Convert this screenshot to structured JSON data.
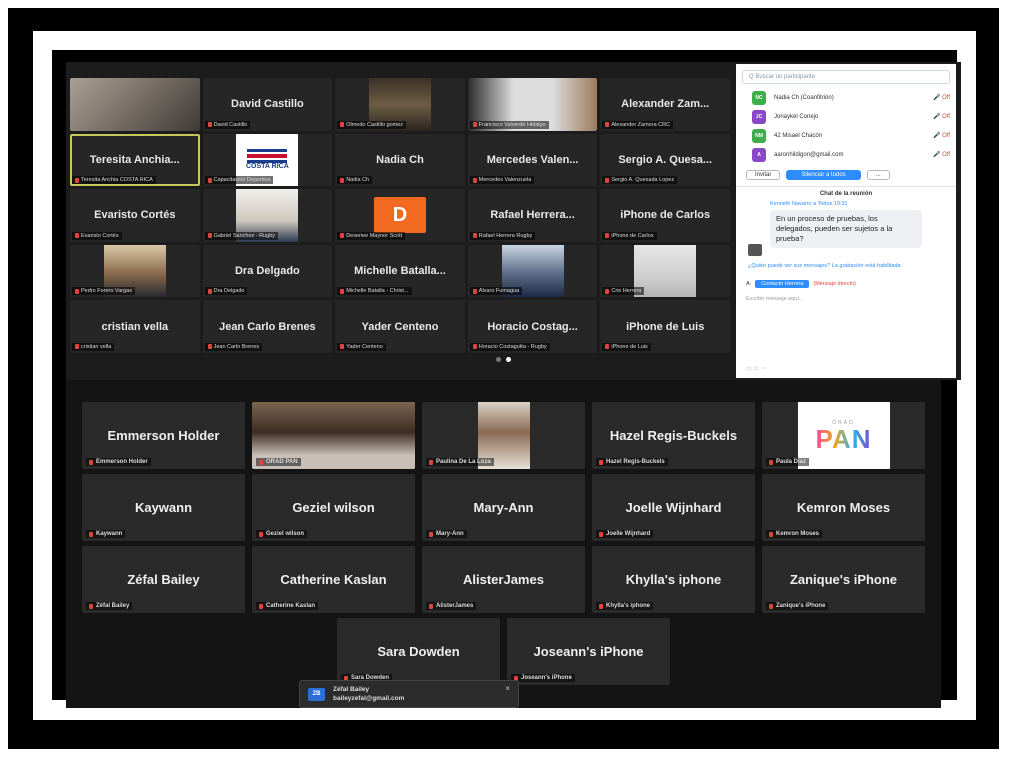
{
  "top": {
    "tiles": [
      {
        "name": "",
        "caption": "",
        "kind": "face1"
      },
      {
        "name": "David Castillo",
        "caption": "David Castillo"
      },
      {
        "name": "",
        "caption": "Olmedo Castillo gomez",
        "kind": "room"
      },
      {
        "name": "",
        "caption": "Francisco Valverde Hidalgo",
        "kind": "wide"
      },
      {
        "name": "Alexander Zam...",
        "caption": "Alexander Zamora CRC"
      },
      {
        "name": "Teresita Anchia...",
        "caption": "Teresita Anchia COSTA RICA",
        "active": true
      },
      {
        "name": "",
        "caption": "Capacitacion Deportiva",
        "kind": "flag"
      },
      {
        "name": "Nadia Ch",
        "caption": "Nadia Ch"
      },
      {
        "name": "Mercedes Valen...",
        "caption": "Mercedes Valenzuela"
      },
      {
        "name": "Sergio A. Quesa...",
        "caption": "Sergio A. Quesada Lopez"
      },
      {
        "name": "Evaristo Cortés",
        "caption": "Evaristo Cortés"
      },
      {
        "name": "",
        "caption": "Gabriel Sanchez - Rugby",
        "kind": "face2"
      },
      {
        "name": "",
        "caption": "Deseriee Maynor Scott",
        "kind": "letter"
      },
      {
        "name": "Rafael Herrera...",
        "caption": "Rafael Herrera Rugby"
      },
      {
        "name": "iPhone de Carlos",
        "caption": "iPhone de Carlos"
      },
      {
        "name": "",
        "caption": "Pedro Forero Vargas",
        "kind": "face3"
      },
      {
        "name": "Dra Delgado",
        "caption": "Dra Delgado"
      },
      {
        "name": "Michelle Batalla...",
        "caption": "Michelle Batalla - Christ..."
      },
      {
        "name": "",
        "caption": "Alvaro Fumagua",
        "kind": "face4"
      },
      {
        "name": "",
        "caption": "Cris Herrera",
        "kind": "face5"
      },
      {
        "name": "cristian vella",
        "caption": "cristian vella"
      },
      {
        "name": "Jean Carlo Brenes",
        "caption": "Jean Carlo Brenes"
      },
      {
        "name": "Yader Centeno",
        "caption": "Yader Centeno"
      },
      {
        "name": "Horacio Costag...",
        "caption": "Horacio Costagutta - Rugby"
      },
      {
        "name": "iPhone de Luis",
        "caption": "iPhone de Luis"
      }
    ],
    "flag_text": "COSTA RICA",
    "letter_avatar": "D"
  },
  "side": {
    "search_placeholder": "Q Buscar un participante",
    "participants": [
      {
        "initials": "NC",
        "name": "Nadia Ch (Coanfitrión)",
        "color": "#3fae4a"
      },
      {
        "initials": "JC",
        "name": "Jonaykel Conejo",
        "color": "#8a48c8"
      },
      {
        "initials": "NM",
        "name": "42 Misael Chacón",
        "color": "#3fae4a"
      },
      {
        "initials": "A",
        "name": "aaronhildigon@gmail.com",
        "color": "#8a48c8"
      }
    ],
    "invite_label": "Invitar",
    "mute_all_label": "Silenciar a todos",
    "more_label": "...",
    "chat_title": "Chat de la reunión",
    "chat_from": "Kenneth Navarro a Todos 19:31",
    "chat_message": "En un proceso de pruebas, los delegados, pueden ser sujetos a la prueba?",
    "system_message": "¿Quién puede ver sus mensajes? La grabación está habilitada",
    "to_label": "A:",
    "to_target": "Contacto Herrera",
    "direct_label": "(Mensaje directo)",
    "input_placeholder": "Escribir mensaje aquí...",
    "mic_status": "🎤 Off"
  },
  "bottom": {
    "tiles": [
      {
        "name": "Emmerson Holder",
        "caption": "Emmerson Holder"
      },
      {
        "name": "",
        "caption": "ORAD PAN",
        "kind": "girl",
        "active": true
      },
      {
        "name": "",
        "caption": "Paulina De La Loza",
        "kind": "lady"
      },
      {
        "name": "Hazel Regis-Buckels",
        "caption": "Hazel Regis-Buckels"
      },
      {
        "name": "",
        "caption": "Paula Diaz",
        "kind": "logo"
      },
      {
        "name": "Kaywann",
        "caption": "Kaywann"
      },
      {
        "name": "Geziel wilson",
        "caption": "Geziel wilson"
      },
      {
        "name": "Mary-Ann",
        "caption": "Mary-Ann"
      },
      {
        "name": "Joelle Wijnhard",
        "caption": "Joelle Wijnhard"
      },
      {
        "name": "Kemron Moses",
        "caption": "Kemron Moses"
      },
      {
        "name": "Zéfal Bailey",
        "caption": "Zéfal Bailey"
      },
      {
        "name": "Catherine Kaslan",
        "caption": "Catherine Kaslan"
      },
      {
        "name": "AlisterJames",
        "caption": "AlisterJames"
      },
      {
        "name": "Khylla's iphone",
        "caption": "Khylla's iphone"
      },
      {
        "name": "Zanique's iPhone",
        "caption": "Zanique's iPhone"
      },
      {
        "name": "Sara Dowden",
        "caption": "Sara Dowden"
      },
      {
        "name": "Joseann's iPhone",
        "caption": "Joseann's iPhone"
      }
    ],
    "logo_top": "ORAD",
    "logo_text": "PAN",
    "toast": {
      "initials": "ZB",
      "name": "Zéfal Bailey",
      "email": "baileyzefal@gmail.com",
      "close": "×"
    }
  }
}
